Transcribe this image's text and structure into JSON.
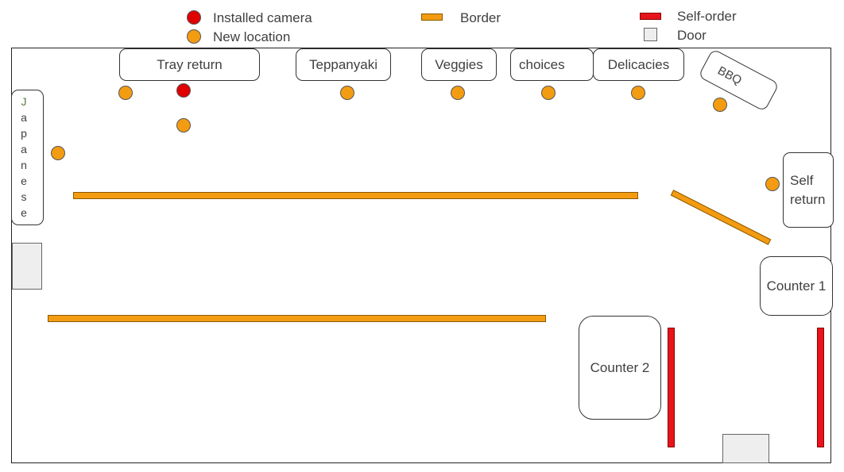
{
  "legend": {
    "installed_camera": "Installed camera",
    "new_location": "New location",
    "border": "Border",
    "self_order": "Self-order",
    "door": "Door"
  },
  "stations": {
    "tray_return": "Tray return",
    "teppanyaki": "Teppanyaki",
    "veggies": "Veggies",
    "choices": "choices",
    "delicacies": "Delicacies",
    "bbq": "BBQ",
    "japanese": "Japanese",
    "self_return_line1": "Self",
    "self_return_line2": "return",
    "counter1": "Counter 1",
    "counter2": "Counter 2"
  },
  "colors": {
    "installed_camera": "#e00000",
    "new_location": "#f39c12",
    "border": "#f39c12",
    "self_order": "#e8141c",
    "door": "#eeeeee"
  }
}
